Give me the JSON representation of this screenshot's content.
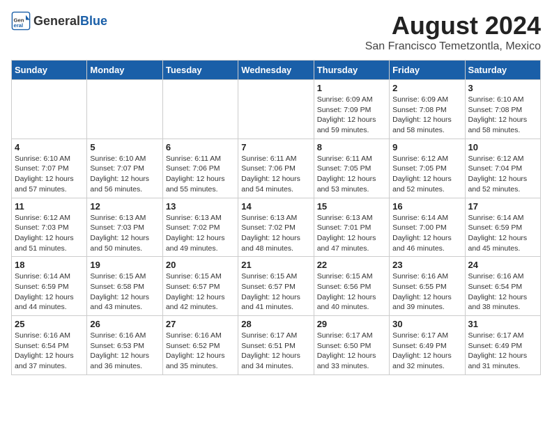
{
  "header": {
    "logo_general": "General",
    "logo_blue": "Blue",
    "main_title": "August 2024",
    "sub_title": "San Francisco Temetzontla, Mexico"
  },
  "calendar": {
    "days_of_week": [
      "Sunday",
      "Monday",
      "Tuesday",
      "Wednesday",
      "Thursday",
      "Friday",
      "Saturday"
    ],
    "weeks": [
      [
        {
          "day": "",
          "info": ""
        },
        {
          "day": "",
          "info": ""
        },
        {
          "day": "",
          "info": ""
        },
        {
          "day": "",
          "info": ""
        },
        {
          "day": "1",
          "info": "Sunrise: 6:09 AM\nSunset: 7:09 PM\nDaylight: 12 hours\nand 59 minutes."
        },
        {
          "day": "2",
          "info": "Sunrise: 6:09 AM\nSunset: 7:08 PM\nDaylight: 12 hours\nand 58 minutes."
        },
        {
          "day": "3",
          "info": "Sunrise: 6:10 AM\nSunset: 7:08 PM\nDaylight: 12 hours\nand 58 minutes."
        }
      ],
      [
        {
          "day": "4",
          "info": "Sunrise: 6:10 AM\nSunset: 7:07 PM\nDaylight: 12 hours\nand 57 minutes."
        },
        {
          "day": "5",
          "info": "Sunrise: 6:10 AM\nSunset: 7:07 PM\nDaylight: 12 hours\nand 56 minutes."
        },
        {
          "day": "6",
          "info": "Sunrise: 6:11 AM\nSunset: 7:06 PM\nDaylight: 12 hours\nand 55 minutes."
        },
        {
          "day": "7",
          "info": "Sunrise: 6:11 AM\nSunset: 7:06 PM\nDaylight: 12 hours\nand 54 minutes."
        },
        {
          "day": "8",
          "info": "Sunrise: 6:11 AM\nSunset: 7:05 PM\nDaylight: 12 hours\nand 53 minutes."
        },
        {
          "day": "9",
          "info": "Sunrise: 6:12 AM\nSunset: 7:05 PM\nDaylight: 12 hours\nand 52 minutes."
        },
        {
          "day": "10",
          "info": "Sunrise: 6:12 AM\nSunset: 7:04 PM\nDaylight: 12 hours\nand 52 minutes."
        }
      ],
      [
        {
          "day": "11",
          "info": "Sunrise: 6:12 AM\nSunset: 7:03 PM\nDaylight: 12 hours\nand 51 minutes."
        },
        {
          "day": "12",
          "info": "Sunrise: 6:13 AM\nSunset: 7:03 PM\nDaylight: 12 hours\nand 50 minutes."
        },
        {
          "day": "13",
          "info": "Sunrise: 6:13 AM\nSunset: 7:02 PM\nDaylight: 12 hours\nand 49 minutes."
        },
        {
          "day": "14",
          "info": "Sunrise: 6:13 AM\nSunset: 7:02 PM\nDaylight: 12 hours\nand 48 minutes."
        },
        {
          "day": "15",
          "info": "Sunrise: 6:13 AM\nSunset: 7:01 PM\nDaylight: 12 hours\nand 47 minutes."
        },
        {
          "day": "16",
          "info": "Sunrise: 6:14 AM\nSunset: 7:00 PM\nDaylight: 12 hours\nand 46 minutes."
        },
        {
          "day": "17",
          "info": "Sunrise: 6:14 AM\nSunset: 6:59 PM\nDaylight: 12 hours\nand 45 minutes."
        }
      ],
      [
        {
          "day": "18",
          "info": "Sunrise: 6:14 AM\nSunset: 6:59 PM\nDaylight: 12 hours\nand 44 minutes."
        },
        {
          "day": "19",
          "info": "Sunrise: 6:15 AM\nSunset: 6:58 PM\nDaylight: 12 hours\nand 43 minutes."
        },
        {
          "day": "20",
          "info": "Sunrise: 6:15 AM\nSunset: 6:57 PM\nDaylight: 12 hours\nand 42 minutes."
        },
        {
          "day": "21",
          "info": "Sunrise: 6:15 AM\nSunset: 6:57 PM\nDaylight: 12 hours\nand 41 minutes."
        },
        {
          "day": "22",
          "info": "Sunrise: 6:15 AM\nSunset: 6:56 PM\nDaylight: 12 hours\nand 40 minutes."
        },
        {
          "day": "23",
          "info": "Sunrise: 6:16 AM\nSunset: 6:55 PM\nDaylight: 12 hours\nand 39 minutes."
        },
        {
          "day": "24",
          "info": "Sunrise: 6:16 AM\nSunset: 6:54 PM\nDaylight: 12 hours\nand 38 minutes."
        }
      ],
      [
        {
          "day": "25",
          "info": "Sunrise: 6:16 AM\nSunset: 6:54 PM\nDaylight: 12 hours\nand 37 minutes."
        },
        {
          "day": "26",
          "info": "Sunrise: 6:16 AM\nSunset: 6:53 PM\nDaylight: 12 hours\nand 36 minutes."
        },
        {
          "day": "27",
          "info": "Sunrise: 6:16 AM\nSunset: 6:52 PM\nDaylight: 12 hours\nand 35 minutes."
        },
        {
          "day": "28",
          "info": "Sunrise: 6:17 AM\nSunset: 6:51 PM\nDaylight: 12 hours\nand 34 minutes."
        },
        {
          "day": "29",
          "info": "Sunrise: 6:17 AM\nSunset: 6:50 PM\nDaylight: 12 hours\nand 33 minutes."
        },
        {
          "day": "30",
          "info": "Sunrise: 6:17 AM\nSunset: 6:49 PM\nDaylight: 12 hours\nand 32 minutes."
        },
        {
          "day": "31",
          "info": "Sunrise: 6:17 AM\nSunset: 6:49 PM\nDaylight: 12 hours\nand 31 minutes."
        }
      ]
    ]
  }
}
